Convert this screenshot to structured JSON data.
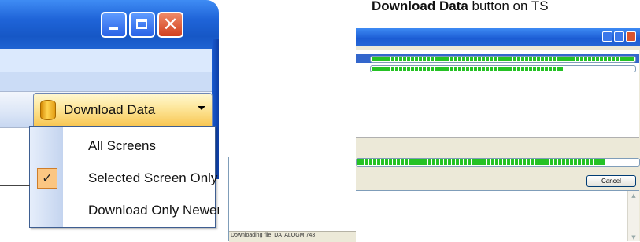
{
  "caption": {
    "bold": "Download Data",
    "rest": " button on TS"
  },
  "window": {
    "caption_buttons": [
      "minimize-icon",
      "maximize-icon",
      "close-icon"
    ],
    "close_glyph": "✕"
  },
  "toolbar": {
    "download_label": "Download Data",
    "download_icon": "database-icon"
  },
  "menu": {
    "items": [
      {
        "label": "All Screens",
        "checked": false
      },
      {
        "label": "Selected Screen Only",
        "checked": true
      },
      {
        "label": "Download Only Newer Files",
        "checked": false
      }
    ],
    "check_glyph": "✓"
  },
  "dialog": {
    "list_progress": [
      1.0,
      0.73
    ],
    "overall_progress": 0.88,
    "cancel_label": "Cancel",
    "status_text": "Downloading file: DATALOGM.743"
  },
  "colors": {
    "title_blue": "#1f64d8",
    "progress_green": "#25c225",
    "selection_blue": "#3366cc",
    "check_orange": "#fbc682"
  }
}
